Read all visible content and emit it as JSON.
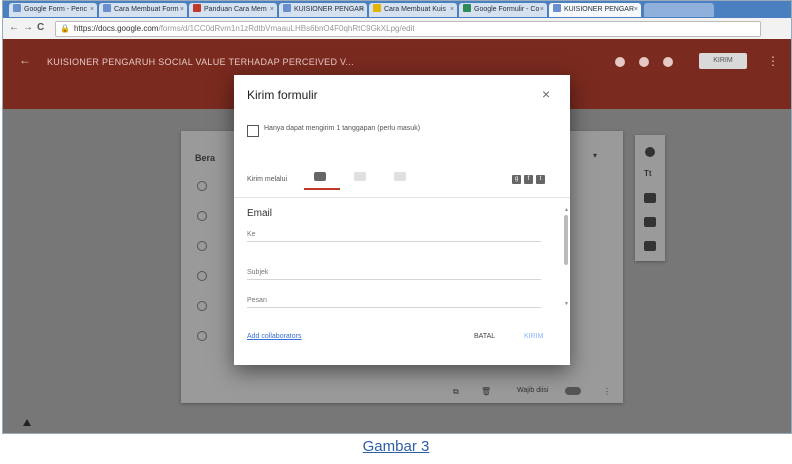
{
  "browser": {
    "tabs": [
      {
        "label": "Google Form - Penc",
        "color": "#6a8fcf"
      },
      {
        "label": "Cara Membuat Form",
        "color": "#6a8fcf"
      },
      {
        "label": "Panduan Cara Mem",
        "color": "#c0392b"
      },
      {
        "label": "KUISIONER PENGAR",
        "color": "#6a8fcf"
      },
      {
        "label": "Cara Membuat Kuis",
        "color": "#e6b400"
      },
      {
        "label": "Google Formulir - Co",
        "color": "#2e8b57"
      },
      {
        "label": "KUISIONER PENGAR",
        "color": "#6a8fcf"
      }
    ],
    "url_host": "https://docs.google.com",
    "url_path": "/forms/d/1CC0dRvm1n1zRdtbVmaauLHBs6bnO4F0qhRtC9GkXLpg/edit",
    "nav_back": "←",
    "nav_forward": "→",
    "nav_reload": "C",
    "lock": "🔒"
  },
  "header": {
    "back": "←",
    "title": "KUISIONER PENGARUH SOCIAL VALUE TERHADAP PERCEIVED V...",
    "send_label": "KIRIM",
    "more": "⋮"
  },
  "form_card": {
    "section_label": "Bera",
    "dropdown_hint": "▾"
  },
  "dialog": {
    "title": "Kirim formulir",
    "close": "×",
    "checkbox_label": "Hanya dapat mengirim 1 tanggapan (perlu masuk)",
    "send_via_label": "Kirim melalui",
    "section_title": "Email",
    "to_placeholder": "Ke",
    "subject_placeholder": "Subjek",
    "message_placeholder": "Pesan",
    "add_collaborators": "Add collaborators",
    "cancel": "BATAL",
    "send": "KIRIM"
  },
  "bottom_toolbar": {
    "required_label": "Wajib diisi"
  },
  "caption": "Gambar 3",
  "colors": {
    "appbar": "#7a2a1f",
    "backdrop": "#777777",
    "accent": "#c0392b",
    "link": "#3a6fd8"
  }
}
